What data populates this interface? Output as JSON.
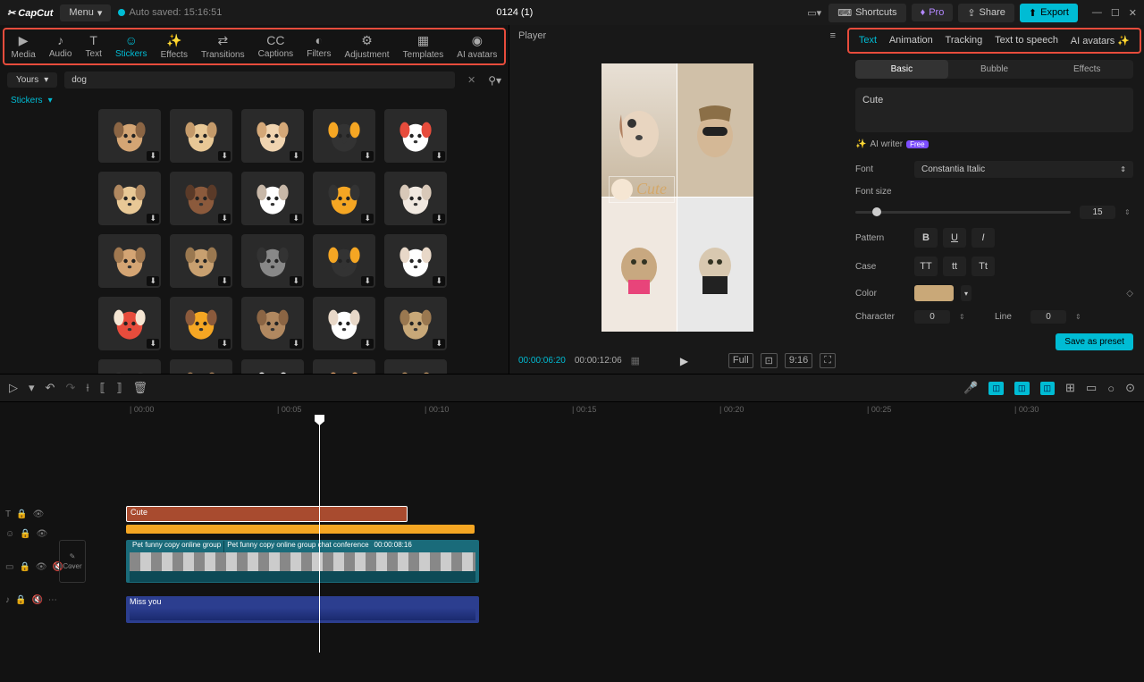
{
  "app": {
    "name": "CapCut",
    "menu": "Menu",
    "autosave": "Auto saved: 15:16:51",
    "project": "0124 (1)"
  },
  "topbar": {
    "shortcuts": "Shortcuts",
    "pro": "Pro",
    "share": "Share",
    "export": "Export"
  },
  "media_tabs": [
    "Media",
    "Audio",
    "Text",
    "Stickers",
    "Effects",
    "Transitions",
    "Captions",
    "Filters",
    "Adjustment",
    "Templates",
    "AI avatars"
  ],
  "media_tabs_active": 3,
  "left": {
    "yours": "Yours",
    "search_value": "dog",
    "category": "Stickers"
  },
  "player": {
    "label": "Player",
    "overlay_text": "Cute",
    "time_current": "00:00:06:20",
    "time_duration": "00:00:12:06",
    "ratio": "9:16"
  },
  "inspector": {
    "tabs": [
      "Text",
      "Animation",
      "Tracking",
      "Text to speech",
      "AI avatars"
    ],
    "tabs_active": 0,
    "subtabs": [
      "Basic",
      "Bubble",
      "Effects"
    ],
    "subtabs_active": 0,
    "text_value": "Cute",
    "ai_writer": "AI writer",
    "ai_badge": "Free",
    "font_label": "Font",
    "font_value": "Constantia Italic",
    "size_label": "Font size",
    "size_value": "15",
    "pattern_label": "Pattern",
    "pattern_btns": [
      "B",
      "U",
      "I"
    ],
    "case_label": "Case",
    "case_btns": [
      "TT",
      "tt",
      "Tt"
    ],
    "color_label": "Color",
    "color_value": "#c9a878",
    "char_label": "Character",
    "char_value": "0",
    "line_label": "Line",
    "line_value": "0",
    "save_preset": "Save as preset"
  },
  "timeline": {
    "ticks": [
      "00:00",
      "00:05",
      "00:10",
      "00:15",
      "00:20",
      "00:25",
      "00:30"
    ],
    "text_clip": "Cute",
    "video_clip_a": "Pet funny copy online group",
    "video_clip_b": "Pet funny copy online group chat conference",
    "video_clip_time": "00:00:08:16",
    "audio_clip": "Miss you",
    "cover": "Cover"
  }
}
